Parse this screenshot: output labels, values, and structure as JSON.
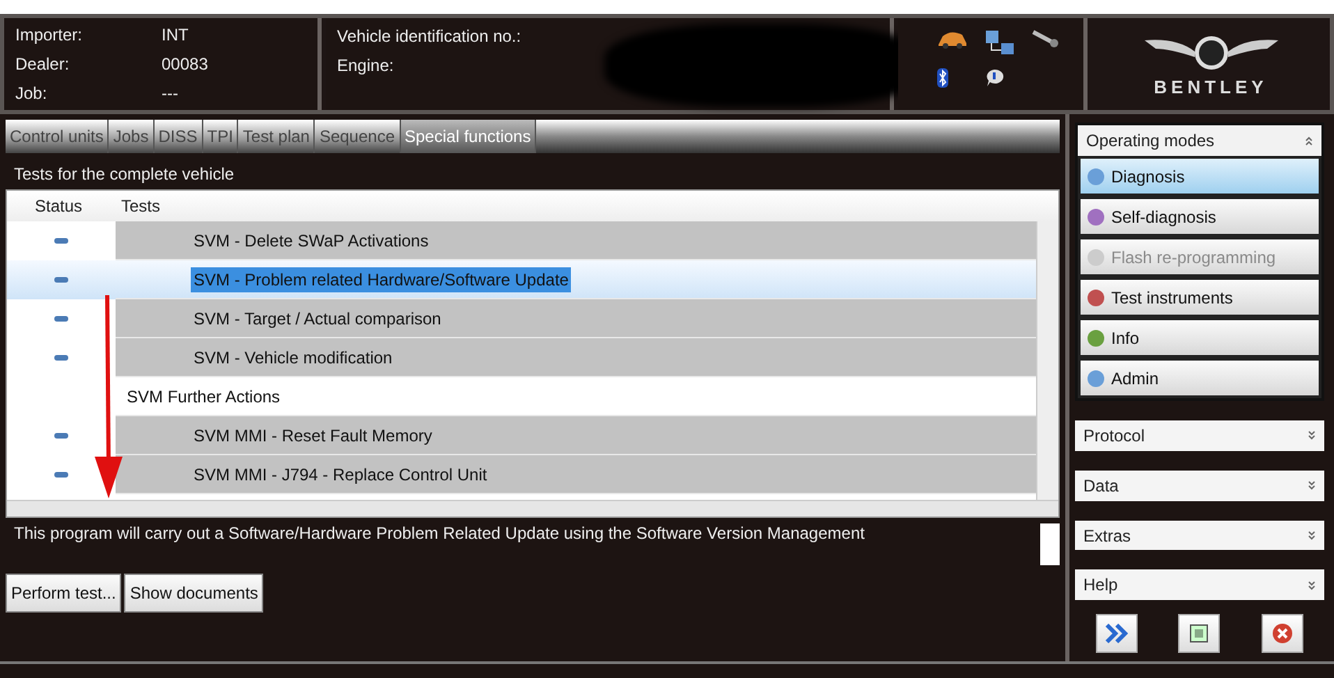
{
  "header": {
    "fields": [
      {
        "label": "Importer:",
        "value": "INT"
      },
      {
        "label": "Dealer:",
        "value": "00083"
      },
      {
        "label": "Job:",
        "value": "---"
      }
    ],
    "vehicle_fields": [
      {
        "label": "Vehicle identification no.:",
        "redacted": true
      },
      {
        "label": "Engine:"
      }
    ],
    "brand": "BENTLEY"
  },
  "tabs": [
    {
      "label": "Control units",
      "selected": false
    },
    {
      "label": "Jobs",
      "selected": false
    },
    {
      "label": "DISS",
      "selected": false
    },
    {
      "label": "TPI",
      "selected": false
    },
    {
      "label": "Test plan",
      "selected": false
    },
    {
      "label": "Sequence",
      "selected": false
    },
    {
      "label": "Special functions",
      "selected": true
    }
  ],
  "section_title": "Tests for the complete vehicle",
  "table": {
    "columns": [
      "Status",
      "Tests"
    ],
    "rows": [
      {
        "kind": "test",
        "label": "SVM - Delete SWaP Activations",
        "selected": false
      },
      {
        "kind": "test",
        "label": "SVM - Problem related Hardware/Software Update",
        "selected": true
      },
      {
        "kind": "test",
        "label": "SVM - Target / Actual comparison",
        "selected": false
      },
      {
        "kind": "test",
        "label": "SVM - Vehicle modification",
        "selected": false
      },
      {
        "kind": "group",
        "label": "SVM Further Actions",
        "selected": false
      },
      {
        "kind": "test",
        "label": "SVM MMI -  Reset Fault Memory",
        "selected": false
      },
      {
        "kind": "test",
        "label": "SVM  MMI - J794 - Replace Control Unit",
        "selected": false
      }
    ]
  },
  "description": "This program will carry out a Software/Hardware Problem Related Update using the Software Version Management",
  "buttons": [
    "Perform test...",
    "Show documents"
  ],
  "sidebar": {
    "title": "Operating modes",
    "modes": [
      {
        "label": "Diagnosis",
        "selected": true,
        "disabled": false
      },
      {
        "label": "Self-diagnosis",
        "selected": false,
        "disabled": false
      },
      {
        "label": "Flash re-programming",
        "selected": false,
        "disabled": true
      },
      {
        "label": "Test instruments",
        "selected": false,
        "disabled": false
      },
      {
        "label": "Info",
        "selected": false,
        "disabled": false
      },
      {
        "label": "Admin",
        "selected": false,
        "disabled": false
      }
    ],
    "sections": [
      "Protocol",
      "Data",
      "Extras",
      "Help"
    ]
  }
}
